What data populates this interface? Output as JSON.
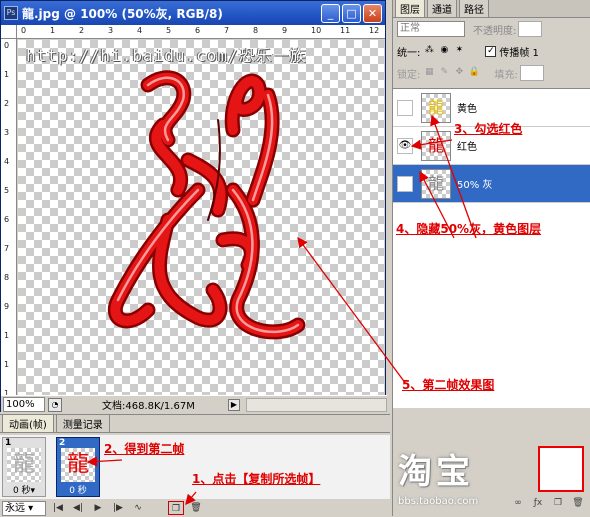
{
  "document": {
    "title": "龍.jpg @ 100% (50%灰, RGB/8)",
    "watermark": "http://hi.baidu.com/恐乐一族",
    "zoom": "100%",
    "doc_info": "文档:468.8K/1.67M",
    "ruler_top_labels": [
      "0",
      "1",
      "2",
      "3",
      "4",
      "5",
      "6",
      "7",
      "8",
      "9",
      "10",
      "11",
      "12"
    ],
    "ruler_left_labels": [
      "0",
      "1",
      "2",
      "3",
      "4",
      "5",
      "6",
      "7",
      "8",
      "9",
      "1",
      "1",
      "1"
    ]
  },
  "window_buttons": {
    "minimize": "_",
    "maximize": "□",
    "close": "✕"
  },
  "animation": {
    "tabs": [
      "动画(帧)",
      "测量记录"
    ],
    "frames": [
      {
        "number": "1",
        "duration": "0 秒▾"
      },
      {
        "number": "2",
        "duration": "0 秒"
      }
    ],
    "loop": "永远 ▾"
  },
  "layers_panel": {
    "tabs": [
      "图层",
      "通道",
      "路径"
    ],
    "blend_mode": "正常",
    "opacity_label": "不透明度:",
    "unify_label": "统一:",
    "propagate_label": "传播帧 1",
    "lock_label": "锁定:",
    "fill_label": "填充:",
    "layers": [
      {
        "name": "黄色",
        "eye": "",
        "thumb_color": "#e8c000"
      },
      {
        "name": "红色",
        "eye": "👁",
        "thumb_color": "#dd0000"
      },
      {
        "name": "50% 灰",
        "eye": "",
        "thumb_color": "#888888"
      }
    ]
  },
  "annotations": {
    "step1": "1、点击【复制所选帧】",
    "step2": "2、得到第二帧",
    "step3": "3、勾选红色",
    "step4": "4、隐藏50%灰，黄色图层",
    "step5": "5、第二帧效果图"
  },
  "stamp": {
    "brand": "淘宝",
    "url": "bbs.taobao.com"
  },
  "colors": {
    "accent_red": "#e00000",
    "selection_blue": "#316ac5",
    "title_blue": "#2255c4"
  }
}
